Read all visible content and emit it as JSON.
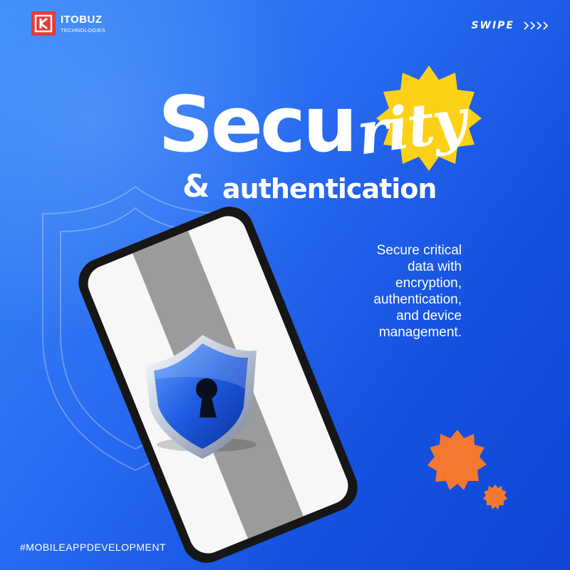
{
  "brand": {
    "name": "ITOBUZ",
    "tagline": "TECHNOLOGIES",
    "logo_color": "#e23b3b"
  },
  "nav": {
    "swipe_label": "SWIPE",
    "swipe_icon": "chevrons-right-icon"
  },
  "headline": {
    "part1": "Secu",
    "part2": "rity",
    "ampersand": "&",
    "subtitle": "authentication"
  },
  "description": {
    "lines": [
      "Secure critical",
      "data with",
      "encryption,",
      "authentication,",
      "and device",
      "management."
    ]
  },
  "hashtag": "#MOBILEAPPDEVELOPMENT",
  "illustration": {
    "phone_icon": "smartphone-icon",
    "shield_icon": "shield-keyhole-icon",
    "outline_icon": "shield-outline-icon"
  },
  "colors": {
    "background_start": "#3d8bf7",
    "background_end": "#0f45d6",
    "sun_yellow": "#fdd216",
    "burst_orange": "#f4782f",
    "shield_blue": "#1d5be0"
  }
}
